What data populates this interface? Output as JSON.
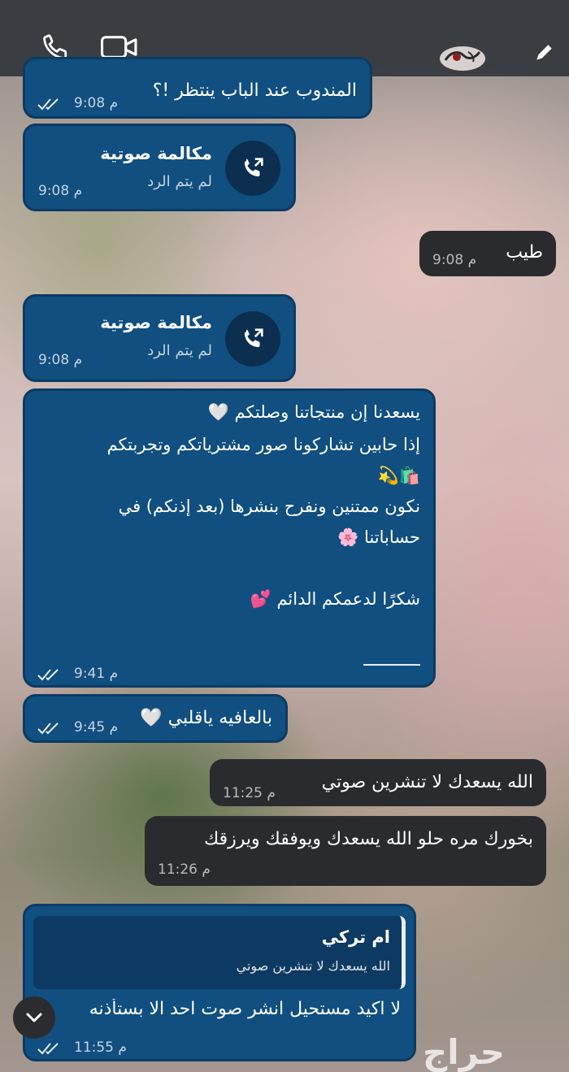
{
  "header": {
    "icons": [
      "phone-icon",
      "video-icon",
      "avatar",
      "edit-icon"
    ]
  },
  "messages": [
    {
      "text": "المندوب عند الباب ينتظر !؟",
      "time": "9:08 م"
    },
    {
      "call_title": "مكالمة صوتية",
      "call_sub": "لم يتم الرد",
      "time": "9:08 م"
    },
    {
      "text": "طيب",
      "time": "9:08 م"
    },
    {
      "call_title": "مكالمة صوتية",
      "call_sub": "لم يتم الرد",
      "time": "9:08 م"
    },
    {
      "lines": [
        "يسعدنا إن منتجاتنا وصلتكم 🤍",
        "إذا حابين تشاركونا صور مشترياتكم وتجربتكم",
        "🛍️💫",
        "نكون ممتنين ونفرح بنشرها (بعد إذنكم) في",
        "حساباتنا 🌸",
        "",
        "شكرًا لدعمكم الدائم 💕"
      ],
      "time": "9:41 م"
    },
    {
      "text": "بالعافيه ياقلبي 🤍",
      "time": "9:45 م"
    },
    {
      "text": "الله يسعدك لا تنشرين صوتي",
      "time": "11:25 م"
    },
    {
      "text": "بخورك مره حلو الله يسعدك ويوفقك ويرزقك",
      "time": "11:26 م"
    },
    {
      "reply_name": "ام تركي",
      "reply_text": "الله يسعدك لا تنشرين صوتي",
      "text": "لا اكيد مستحيل انشر صوت احد الا بستأذنه",
      "time": "11:55 م"
    }
  ],
  "watermark": "حراج"
}
